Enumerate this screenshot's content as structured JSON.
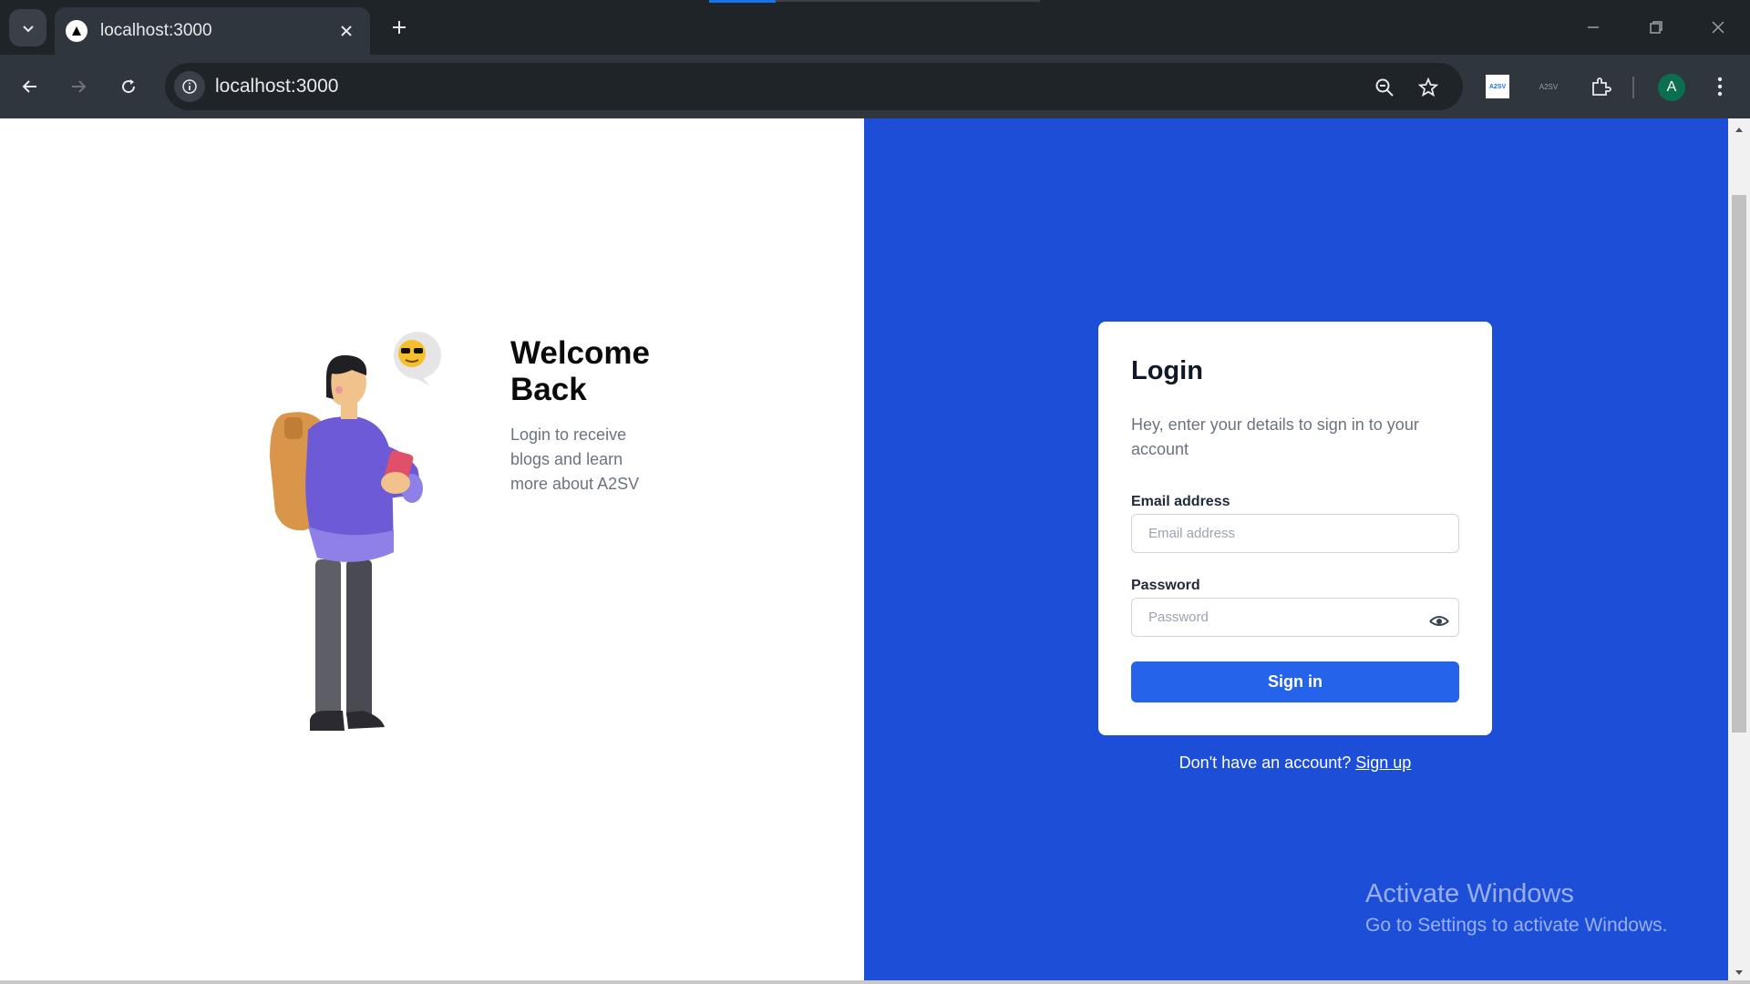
{
  "browser": {
    "tab_title": "localhost:3000",
    "url": "localhost:3000",
    "extensions": [
      "A2SV",
      "A2SV"
    ],
    "profile_initial": "A"
  },
  "hero": {
    "title": "Welcome Back",
    "subtitle": "Login to receive blogs and learn more about A2SV"
  },
  "login": {
    "title": "Login",
    "subtitle": "Hey, enter your details to sign in to your account",
    "email_label": "Email address",
    "email_placeholder": "Email address",
    "password_label": "Password",
    "password_placeholder": "Password",
    "submit_label": "Sign in",
    "signup_prompt": "Don't have an account?",
    "signup_link": "Sign up"
  },
  "watermark": {
    "title": "Activate Windows",
    "subtitle": "Go to Settings to activate Windows."
  },
  "colors": {
    "brand_blue": "#1d4ed8",
    "button_blue": "#2563eb"
  }
}
